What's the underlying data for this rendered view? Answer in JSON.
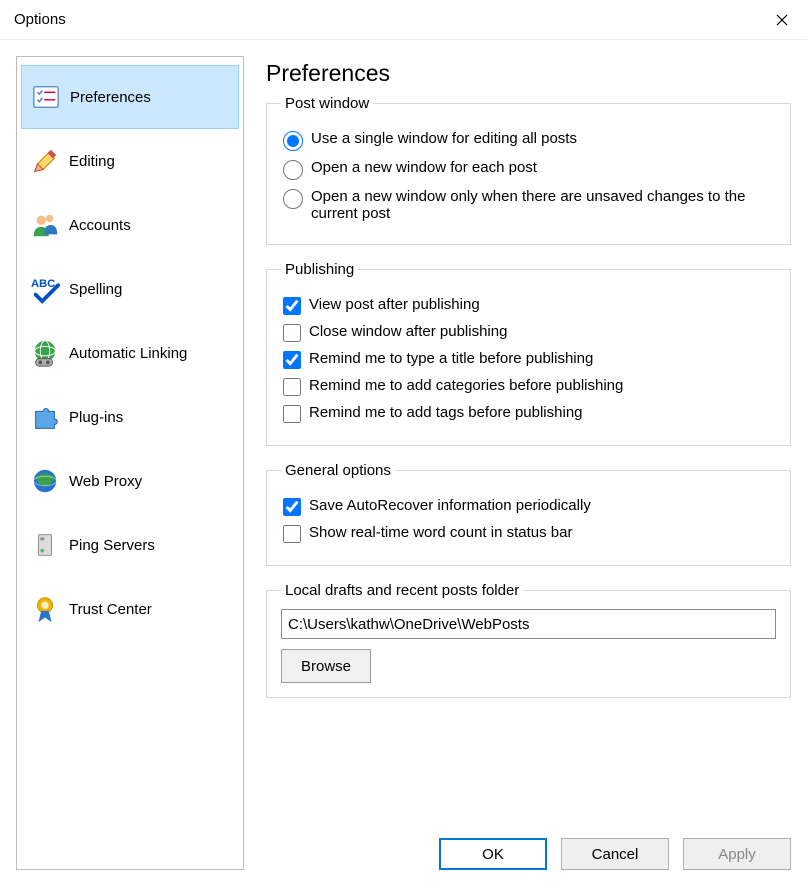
{
  "window": {
    "title": "Options"
  },
  "sidebar": {
    "items": [
      {
        "label": "Preferences",
        "selected": true
      },
      {
        "label": "Editing"
      },
      {
        "label": "Accounts"
      },
      {
        "label": "Spelling"
      },
      {
        "label": "Automatic Linking"
      },
      {
        "label": "Plug-ins"
      },
      {
        "label": "Web Proxy"
      },
      {
        "label": "Ping Servers"
      },
      {
        "label": "Trust Center"
      }
    ]
  },
  "preferences": {
    "heading": "Preferences",
    "post_window": {
      "legend": "Post window",
      "options": [
        {
          "label": "Use a single window for editing all posts",
          "selected": true
        },
        {
          "label": "Open a new window for each post",
          "selected": false
        },
        {
          "label": "Open a new window only when there are unsaved changes to the current post",
          "selected": false
        }
      ]
    },
    "publishing": {
      "legend": "Publishing",
      "options": [
        {
          "label": "View post after publishing",
          "checked": true
        },
        {
          "label": "Close window after publishing",
          "checked": false
        },
        {
          "label": "Remind me to type a title before publishing",
          "checked": true
        },
        {
          "label": "Remind me to add categories before publishing",
          "checked": false
        },
        {
          "label": "Remind me to add tags before publishing",
          "checked": false
        }
      ]
    },
    "general": {
      "legend": "General options",
      "options": [
        {
          "label": "Save AutoRecover information periodically",
          "checked": true
        },
        {
          "label": "Show real-time word count in status bar",
          "checked": false
        }
      ]
    },
    "folder": {
      "legend": "Local drafts and recent posts folder",
      "path": "C:\\Users\\kathw\\OneDrive\\WebPosts",
      "browse": "Browse"
    }
  },
  "buttons": {
    "ok": "OK",
    "cancel": "Cancel",
    "apply": "Apply"
  }
}
